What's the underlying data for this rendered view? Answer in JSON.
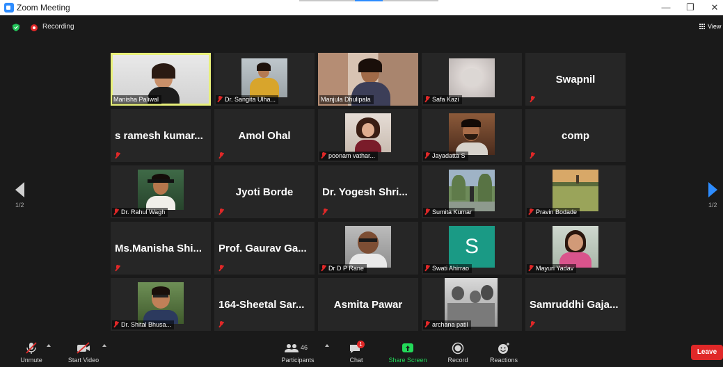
{
  "window": {
    "title": "Zoom Meeting",
    "minimize": "—",
    "restore": "❐",
    "close": "✕"
  },
  "meeting": {
    "recording_label": "Recording",
    "view_label": "View"
  },
  "pager": {
    "left_page": "1/2",
    "right_page": "1/2"
  },
  "participants": [
    {
      "name": "Manisha Paliwal",
      "type": "video",
      "active_speaker": true,
      "muted": false
    },
    {
      "name": "Dr. Sangita Ulha...",
      "type": "photo",
      "muted": true
    },
    {
      "name": "Manjula Dhulipala",
      "type": "video",
      "muted": false
    },
    {
      "name": "Safa Kazi",
      "type": "photo",
      "muted": true
    },
    {
      "name": "Swapnil",
      "type": "name",
      "muted": true
    },
    {
      "name": "s ramesh kumar...",
      "type": "name",
      "muted": true
    },
    {
      "name": "Amol Ohal",
      "type": "name",
      "muted": true
    },
    {
      "name": "poonam vathar...",
      "type": "photo",
      "muted": true
    },
    {
      "name": "Jayadatta S",
      "type": "photo",
      "muted": true
    },
    {
      "name": "comp",
      "type": "name",
      "muted": true
    },
    {
      "name": "Dr. Rahul Wagh",
      "type": "photo",
      "muted": true
    },
    {
      "name": "Jyoti Borde",
      "type": "name",
      "muted": true
    },
    {
      "name": "Dr. Yogesh Shri...",
      "type": "name",
      "muted": true
    },
    {
      "name": "Sumita Kumar",
      "type": "photo",
      "muted": true
    },
    {
      "name": "Pravin Bodade",
      "type": "photo",
      "muted": true
    },
    {
      "name": "Ms.Manisha Shi...",
      "type": "name",
      "muted": true
    },
    {
      "name": "Prof. Gaurav Ga...",
      "type": "name",
      "muted": true
    },
    {
      "name": "Dr D P Rane",
      "type": "photo",
      "muted": true
    },
    {
      "name": "Swati Ahirrao",
      "type": "avatar",
      "initial": "S",
      "muted": true
    },
    {
      "name": "Mayuri Yadav",
      "type": "photo",
      "muted": true
    },
    {
      "name": "Dr. Shital Bhusa...",
      "type": "photo",
      "muted": true
    },
    {
      "name": "164-Sheetal Sar...",
      "type": "name",
      "muted": true
    },
    {
      "name": "Asmita Pawar",
      "type": "name",
      "muted": false
    },
    {
      "name": "archana patil",
      "type": "photo",
      "muted": true
    },
    {
      "name": "Samruddhi Gaja...",
      "type": "name",
      "muted": true
    }
  ],
  "toolbar": {
    "unmute": "Unmute",
    "start_video": "Start Video",
    "participants": "Participants",
    "participants_count": "46",
    "chat": "Chat",
    "chat_badge": "1",
    "share_screen": "Share Screen",
    "record": "Record",
    "reactions": "Reactions",
    "leave": "Leave"
  },
  "colors": {
    "accent": "#2d8cff",
    "active_speaker": "#e8f07a",
    "share": "#23d959",
    "danger": "#e02828",
    "avatar_teal": "#1a9a85"
  }
}
